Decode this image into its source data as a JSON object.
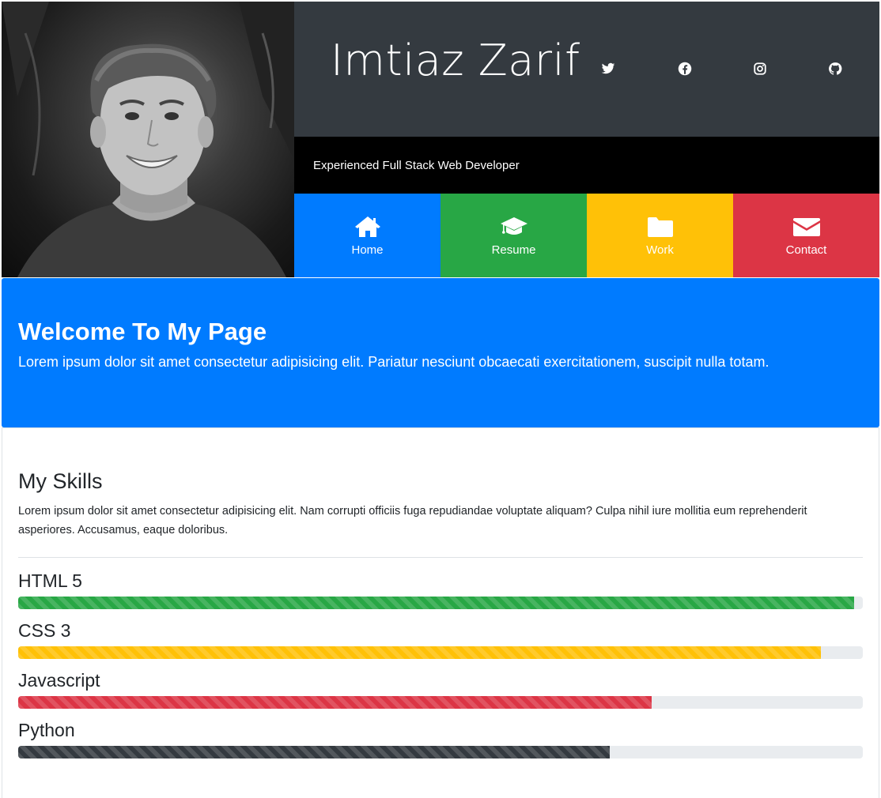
{
  "header": {
    "name": "Imtiaz Zarif",
    "tagline": "Experienced Full Stack Web Developer",
    "social": [
      "twitter-icon",
      "facebook-icon",
      "instagram-icon",
      "github-icon"
    ]
  },
  "nav": {
    "items": [
      {
        "label": "Home",
        "icon": "home-icon",
        "color": "#007bff"
      },
      {
        "label": "Resume",
        "icon": "graduation-cap-icon",
        "color": "#28a745"
      },
      {
        "label": "Work",
        "icon": "folder-icon",
        "color": "#ffc107"
      },
      {
        "label": "Contact",
        "icon": "envelope-icon",
        "color": "#dc3545"
      }
    ]
  },
  "welcome": {
    "title": "Welcome To My Page",
    "text": "Lorem ipsum dolor sit amet consectetur adipisicing elit. Pariatur nesciunt obcaecati exercitationem, suscipit nulla totam."
  },
  "skills": {
    "title": "My Skills",
    "intro": "Lorem ipsum dolor sit amet consectetur adipisicing elit. Nam corrupti officiis fuga repudiandae voluptate aliquam? Culpa nihil iure mollitia eum reprehenderit asperiores. Accusamus, eaque doloribus.",
    "items": [
      {
        "name": "HTML 5",
        "percent": 99,
        "color": "#28a745"
      },
      {
        "name": "CSS 3",
        "percent": 95,
        "color": "#ffc107"
      },
      {
        "name": "Javascript",
        "percent": 75,
        "color": "#dc3545"
      },
      {
        "name": "Python",
        "percent": 70,
        "color": "#343a40"
      }
    ]
  }
}
